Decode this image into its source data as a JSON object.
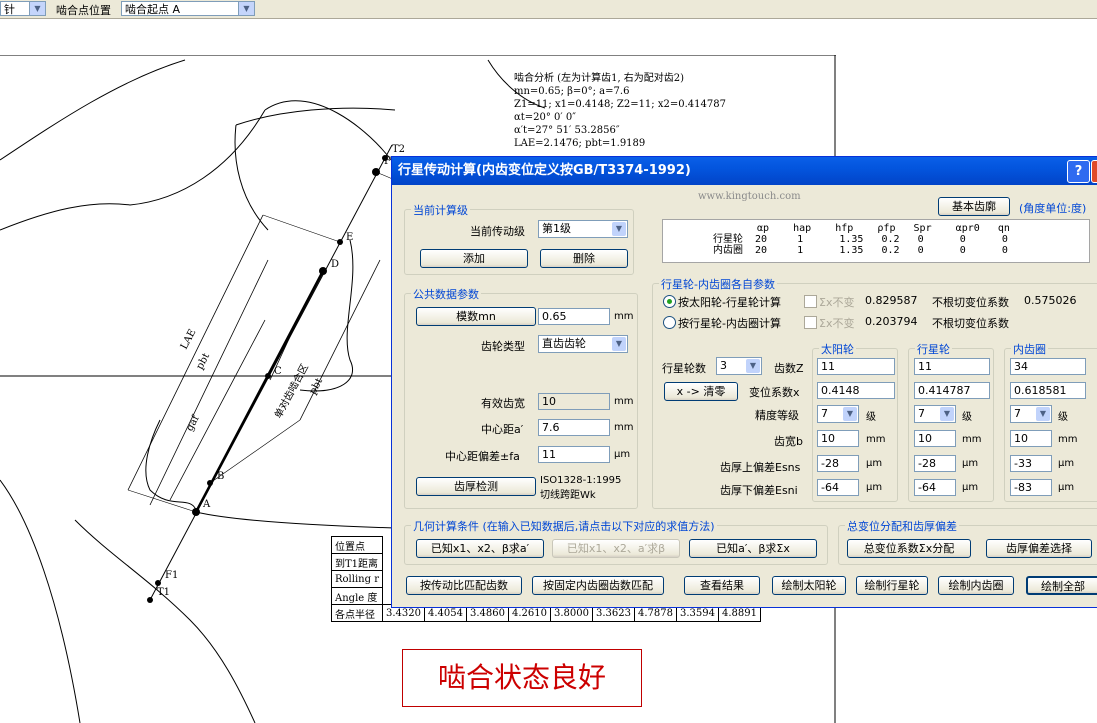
{
  "toolbar": {
    "left_combo_fragment": "针",
    "mesh_point_label": "啮合点位置",
    "mesh_point_value": "啮合起点 A"
  },
  "analysis": {
    "lines": [
      "啮合分析 (左为计算齿1, 右为配对齿2)",
      "mn=0.65; β=0°; a=7.6",
      "Z1=11; x1=0.4148; Z2=11; x2=0.414787",
      "αt=20° 0′ 0″",
      "α′t=27° 51′ 53.2856″",
      "LAE=2.1476; pbt=1.9189"
    ]
  },
  "drawing_labels": {
    "T2": "T2",
    "F": "F",
    "E": "E",
    "D": "D",
    "C": "C",
    "B": "B",
    "A": "A",
    "F1": "F1",
    "T1": "T1",
    "LAE": "LAE",
    "pbt1": "pbt",
    "pbt2": "pbt",
    "gaf": "gaf",
    "mesh_zone": "单对齿啮合区"
  },
  "result_table": {
    "col0": [
      "位置点",
      "到T1距离",
      "Rolling",
      "Angle",
      "各点半径"
    ],
    "col0_extra": [
      "",
      "",
      "r",
      "度",
      ""
    ],
    "radius_values": [
      "3.4320",
      "4.4054",
      "3.4860",
      "4.2610",
      "3.8000",
      "3.3623",
      "4.7878",
      "3.3594",
      "4.8891"
    ]
  },
  "status_message": "啮合状态良好",
  "dialog": {
    "title": "行星传动计算(内齿变位定义按GB/T3374-1992)",
    "help_btn": "?",
    "close_btn": "×",
    "watermark": "www.kingtouch.com",
    "basic_profile_btn": "基本齿廓",
    "angle_unit_note": "(角度单位:度)",
    "profile_table": {
      "header": "αp    hap    hfp    ρfp   Spr    αpr0   qn",
      "row1": "行星轮  20     1      1.35   0.2   0      0      0",
      "row2": "内齿圈  20     1      1.35   0.2   0      0      0"
    },
    "current_stage": {
      "group_title": "当前计算级",
      "stage_label": "当前传动级",
      "stage_value": "第1级",
      "add_btn": "添加",
      "delete_btn": "删除"
    },
    "common": {
      "group_title": "公共数据参数",
      "module_btn": "模数mn",
      "module_value": "0.65",
      "module_unit": "mm",
      "gear_type_label": "齿轮类型",
      "gear_type_value": "直齿齿轮",
      "face_width_label": "有效齿宽",
      "face_width_value": "10",
      "face_width_unit": "mm",
      "center_dist_label": "中心距a′",
      "center_dist_value": "7.6",
      "center_dist_unit": "mm",
      "center_dev_label": "中心距偏差±fa",
      "center_dev_value": "11",
      "center_dev_unit": "μm",
      "thickness_btn": "齿厚检测",
      "thickness_note1": "ISO1328-1:1995",
      "thickness_note2": "切线跨距Wk"
    },
    "each_params": {
      "group_title": "行星轮-内齿圈各自参数",
      "opt1": "按太阳轮-行星轮计算",
      "opt1_chk": "Σx不变",
      "opt1_val": "0.829587",
      "opt1_note": "不根切变位系数",
      "opt1_note_val": "0.575026",
      "opt2": "按行星轮-内齿圈计算",
      "opt2_chk": "Σx不变",
      "opt2_val": "0.203794",
      "opt2_note": "不根切变位系数",
      "planet_count_label": "行星轮数",
      "planet_count_value": "3",
      "clear_btn": "x -> 清零",
      "headers": [
        "太阳轮",
        "行星轮",
        "内齿圈"
      ],
      "teeth_label": "齿数Z",
      "teeth": [
        "11",
        "11",
        "34"
      ],
      "shift_label": "变位系数x",
      "shift": [
        "0.4148",
        "0.414787",
        "0.618581"
      ],
      "grade_label": "精度等级",
      "grade": [
        "7",
        "7",
        "7"
      ],
      "grade_unit": "级",
      "width_label": "齿宽b",
      "width": [
        "10",
        "10",
        "10"
      ],
      "width_unit": "mm",
      "upper_label": "齿厚上偏差Esns",
      "upper": [
        "-28",
        "-28",
        "-33"
      ],
      "lower_label": "齿厚下偏差Esni",
      "lower": [
        "-64",
        "-64",
        "-83"
      ],
      "um_unit": "μm"
    },
    "geometry": {
      "group_title": "几何计算条件 (在输入已知数据后,请点击以下对应的求值方法)",
      "btn1": "已知x1、x2、β求a′",
      "btn2": "已知x1、x2、a′求β",
      "btn3": "已知a′、β求Σx"
    },
    "shift_dist": {
      "group_title": "总变位分配和齿厚偏差",
      "btn1": "总变位系数Σx分配",
      "btn2": "齿厚偏差选择"
    },
    "bottom": {
      "btn_ratio": "按传动比匹配齿数",
      "btn_fixed": "按固定内齿圈齿数匹配",
      "btn_results": "查看结果",
      "btn_sun": "绘制太阳轮",
      "btn_planet": "绘制行星轮",
      "btn_ring": "绘制内齿圈",
      "btn_all": "绘制全部"
    }
  }
}
